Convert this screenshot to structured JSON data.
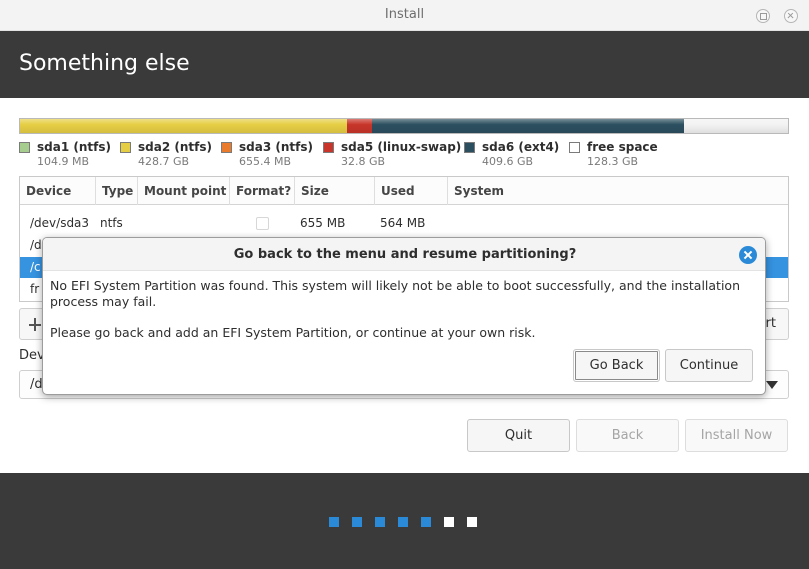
{
  "window": {
    "title": "Install"
  },
  "header": {
    "title": "Something else"
  },
  "colors": {
    "sda1": "#a7cd8e",
    "sda2": "#e6ce44",
    "sda3": "#ea7b2c",
    "sda5": "#c8352a",
    "sda6": "#2c4f60",
    "free": "#f2f2f2",
    "selection": "#3593e0",
    "accent": "#2a8ad8"
  },
  "partition_bar": [
    {
      "id": "sda1",
      "fraction": 0.0001,
      "color": "#a7cd8e"
    },
    {
      "id": "sda2",
      "fraction": 0.4252,
      "color": "#e6ce44"
    },
    {
      "id": "sda3",
      "fraction": 0.0008,
      "color": "#ea7b2c"
    },
    {
      "id": "sda5",
      "fraction": 0.0325,
      "color": "#c8352a"
    },
    {
      "id": "sda6",
      "fraction": 0.4063,
      "color": "#2c4f60"
    },
    {
      "id": "free",
      "fraction": 0.1351,
      "color": "#f2f2f2"
    }
  ],
  "legend": [
    {
      "name": "sda1 (ntfs)",
      "size": "104.9 MB",
      "color": "#a7cd8e"
    },
    {
      "name": "sda2 (ntfs)",
      "size": "428.7 GB",
      "color": "#e6ce44"
    },
    {
      "name": "sda3 (ntfs)",
      "size": "655.4 MB",
      "color": "#ea7b2c"
    },
    {
      "name": "sda5 (linux-swap)",
      "size": "32.8 GB",
      "color": "#c8352a"
    },
    {
      "name": "sda6 (ext4)",
      "size": "409.6 GB",
      "color": "#2c4f60"
    },
    {
      "name": "free space",
      "size": "128.3 GB",
      "color": "#ffffff"
    }
  ],
  "table": {
    "columns": [
      "Device",
      "Type",
      "Mount point",
      "Format?",
      "Size",
      "Used",
      "System"
    ],
    "rows": [
      {
        "device": "/dev/sda3",
        "type": "ntfs",
        "mount": "",
        "size": "655 MB",
        "used": "564 MB",
        "system": ""
      },
      {
        "device": "/d",
        "type": "",
        "mount": "",
        "size": "",
        "used": "",
        "system": ""
      },
      {
        "device": "/c",
        "type": "",
        "mount": "",
        "size": "",
        "used": "",
        "system": ""
      },
      {
        "device": "fr",
        "type": "",
        "mount": "",
        "size": "",
        "used": "",
        "system": ""
      }
    ]
  },
  "revert_label": "rt",
  "device_label": "Dev",
  "boot_device_value": "/d",
  "buttons": {
    "quit": "Quit",
    "back": "Back",
    "install": "Install Now"
  },
  "dialog": {
    "title": "Go back to the menu and resume partitioning?",
    "message1": "No EFI System Partition was found. This system will likely not be able to boot successfully, and the installation process may fail.",
    "message2": "Please go back and add an EFI System Partition, or continue at your own risk.",
    "go_back": "Go Back",
    "continue": "Continue"
  },
  "progress": {
    "steps_total": 7,
    "steps_done": 5,
    "done_color": "#2a8ad8",
    "todo_color": "#ffffff"
  }
}
